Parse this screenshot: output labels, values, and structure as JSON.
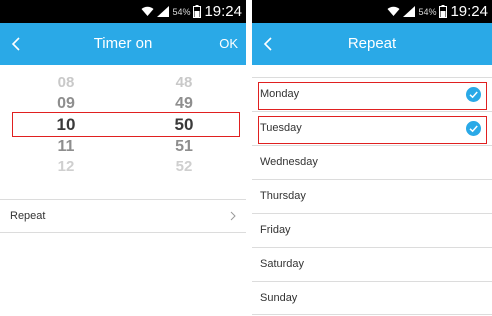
{
  "status_bar": {
    "battery_percent": "54%",
    "time": "19:24"
  },
  "timer_screen": {
    "title": "Timer on",
    "ok_label": "OK",
    "picker": {
      "hours": [
        "08",
        "09",
        "10",
        "11",
        "12"
      ],
      "minutes": [
        "48",
        "49",
        "50",
        "51",
        "52"
      ],
      "selected_hour": "10",
      "selected_minute": "50"
    },
    "repeat_label": "Repeat"
  },
  "repeat_screen": {
    "title": "Repeat",
    "days": [
      {
        "label": "Monday",
        "checked": true,
        "highlighted": true
      },
      {
        "label": "Tuesday",
        "checked": true,
        "highlighted": true
      },
      {
        "label": "Wednesday",
        "checked": false,
        "highlighted": false
      },
      {
        "label": "Thursday",
        "checked": false,
        "highlighted": false
      },
      {
        "label": "Friday",
        "checked": false,
        "highlighted": false
      },
      {
        "label": "Saturday",
        "checked": false,
        "highlighted": false
      },
      {
        "label": "Sunday",
        "checked": false,
        "highlighted": false
      }
    ]
  },
  "colors": {
    "accent": "#2aa9e7",
    "highlight": "#e02020"
  }
}
